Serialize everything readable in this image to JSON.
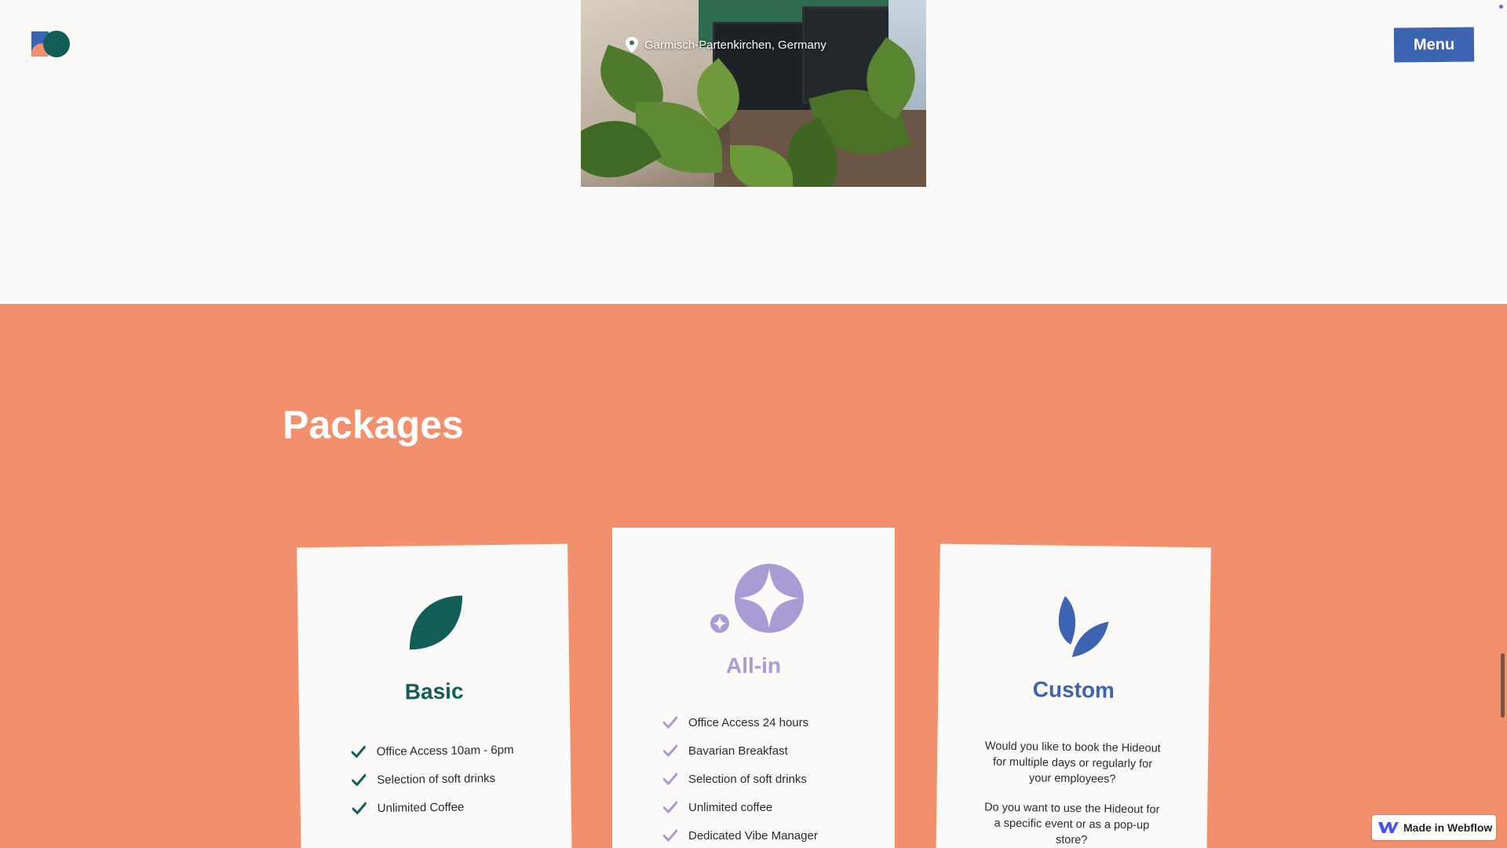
{
  "header": {
    "logo_icon": "brand-logo-icon",
    "menu_label": "Menu"
  },
  "hero": {
    "location_icon": "map-pin-icon",
    "location": "Garmisch-Partenkirchen, Germany"
  },
  "packages": {
    "title": "Packages",
    "cards": [
      {
        "name": "Basic",
        "icon": "leaf-icon",
        "color": "#115e59",
        "features": [
          "Office Access 10am - 6pm",
          "Selection of soft drinks",
          "Unlimited Coffee"
        ]
      },
      {
        "name": "All-in",
        "icon": "sparkle-star-icon",
        "color": "#a99bd4",
        "features": [
          "Office Access 24 hours",
          "Bavarian Breakfast",
          "Selection of soft drinks",
          "Unlimited coffee",
          "Dedicated Vibe Manager"
        ]
      },
      {
        "name": "Custom",
        "icon": "twin-leaves-icon",
        "color": "#3d64b3",
        "paragraphs": [
          "Would you like to book the Hideout for multiple days or regularly for your employees?",
          "Do you want to use the Hideout for a specific event or as a pop-up store?"
        ]
      }
    ]
  },
  "badge": {
    "icon": "webflow-icon",
    "label": "Made in Webflow"
  },
  "colors": {
    "section_background": "#f2906e",
    "page_background": "#fcfaf8",
    "menu_button": "#3d64b3"
  }
}
